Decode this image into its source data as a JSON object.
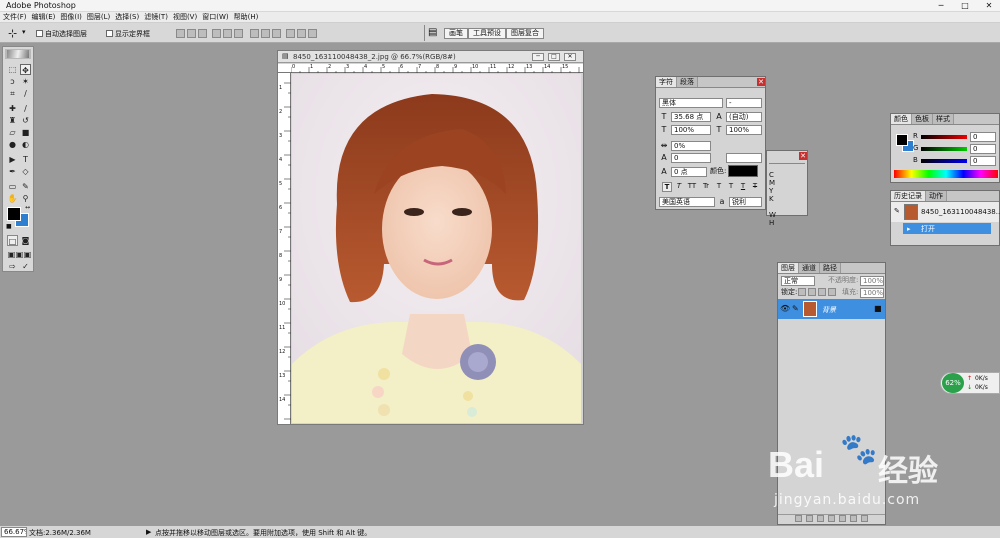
{
  "app": {
    "title": "Adobe Photoshop"
  },
  "menu": [
    "文件(F)",
    "编辑(E)",
    "图像(I)",
    "图层(L)",
    "选择(S)",
    "滤镜(T)",
    "视图(V)",
    "窗口(W)",
    "帮助(H)"
  ],
  "options": {
    "auto_select": "自动选择图层",
    "show_bounds": "显示定界框",
    "well_tabs": [
      "画笔",
      "工具预设",
      "图层复合"
    ]
  },
  "document": {
    "title": "8450_163110048438_2.jpg @ 66.7%(RGB/8#)",
    "ruler_top": [
      "0",
      "1",
      "2",
      "3",
      "4",
      "5",
      "6",
      "7",
      "8",
      "9",
      "10",
      "11",
      "12",
      "13",
      "14",
      "15"
    ],
    "ruler_left": [
      "1",
      "2",
      "3",
      "4",
      "5",
      "6",
      "7",
      "8",
      "9",
      "10",
      "11",
      "12",
      "13",
      "14"
    ]
  },
  "character": {
    "tabs": [
      "字符",
      "段落"
    ],
    "font": "黑体",
    "style": "-",
    "size": "35.68 点",
    "leading": "(自动)",
    "vscale": "100%",
    "hscale": "100%",
    "tracking": "0%",
    "kerning": "0",
    "baseline": "0 点",
    "color_label": "颜色:",
    "style_buttons": [
      "T",
      "T",
      "TT",
      "Tr",
      "T",
      "T",
      "T",
      "T"
    ],
    "language": "美国英语",
    "aa": "锐利"
  },
  "color": {
    "tabs": [
      "颜色",
      "色板",
      "样式"
    ],
    "channels": [
      {
        "name": "R",
        "value": "0"
      },
      {
        "name": "G",
        "value": "0"
      },
      {
        "name": "B",
        "value": "0"
      }
    ],
    "fg": "#000000",
    "bg": "#2e7fcf"
  },
  "history": {
    "tabs": [
      "历史记录",
      "动作"
    ],
    "snapshot": "8450_163110048438...",
    "items": [
      "打开"
    ]
  },
  "layers": {
    "tabs": [
      "图层",
      "通道",
      "路径"
    ],
    "blend": "正常",
    "opacity_label": "不透明度:",
    "opacity": "100%",
    "lock_label": "锁定:",
    "fill_label": "填充:",
    "fill": "100%",
    "items": [
      {
        "name": "背景"
      }
    ]
  },
  "side_letters": [
    "C",
    "M",
    "Y",
    "K",
    "W",
    "H"
  ],
  "network": {
    "percent": "62%",
    "up": "0K/s",
    "down": "0K/s"
  },
  "watermark": {
    "brand": "Bai",
    "brand2": "经验",
    "url": "jingyan.baidu.com"
  },
  "status": {
    "zoom": "66.67%",
    "doc": "文档:2.36M/2.36M",
    "hint": "点按并拖移以移动图层或选区。要用附加选项，使用 Shift 和 Alt 键。"
  },
  "colors": {
    "accent": "#3f8fe0",
    "panel": "#d4d4d4",
    "workspace": "#9a9a9a"
  }
}
